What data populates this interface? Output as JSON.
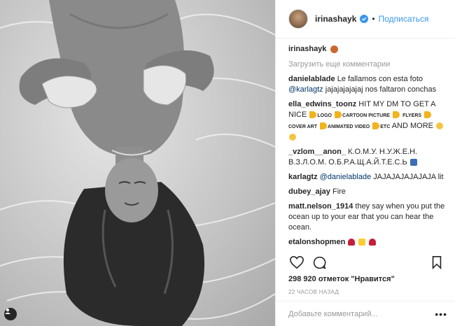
{
  "post": {
    "photo_alt": "",
    "user_badge_icon": "user-icon"
  },
  "header": {
    "username": "irinashayk",
    "separator": "•",
    "follow_label": "Подписаться",
    "accent": "#3897f0"
  },
  "caption": {
    "username": "irinashayk"
  },
  "load_more": "Загрузить еще комментарии",
  "comments": [
    {
      "user": "danielablade",
      "text_a": "Le fallamos con esta foto ",
      "mention": "@karlagtz",
      "text_b": " jajajajajajaj nos faltaron conchas"
    },
    {
      "user": "ella_edwins_toonz",
      "text_a": "HIT MY DM TO GET A NICE",
      "t1": "LOGO",
      "t2": "CARTOON PICTURE",
      "t3": "FLYERS",
      "t4": "COVER ART",
      "t5": "ANIMATED VIDEO",
      "t6": "ETC",
      "text_b": "AND MORE"
    },
    {
      "user": "_vzlom__anon_",
      "text_a": "К.О.М.У. Н.У.Ж.Е.Н. В.З.Л.О.М. О.Б.Р.А.Щ.А.Й.Т.Е.С.Ь"
    },
    {
      "user": "karlagtz",
      "mention": "@danielablade",
      "text_b": " JAJAJAJAJAJAJA lit"
    },
    {
      "user": "dubey_ajay",
      "text_a": "Fire"
    },
    {
      "user": "matt.nelson_1914",
      "text_a": "they say when you put the ocean up to your ear that you can hear the ocean."
    },
    {
      "user": "etalonshopmen"
    }
  ],
  "likes": {
    "count": "298 920",
    "text": " отметок \"Нравится\""
  },
  "timestamp": "22 ЧАСОВ НАЗАД",
  "add_comment_placeholder": "Добавьте комментарий...",
  "more_label": "•••",
  "icons": {
    "like": "heart-icon",
    "comment": "comment-icon",
    "save": "bookmark-icon",
    "verified": "verified-icon"
  }
}
